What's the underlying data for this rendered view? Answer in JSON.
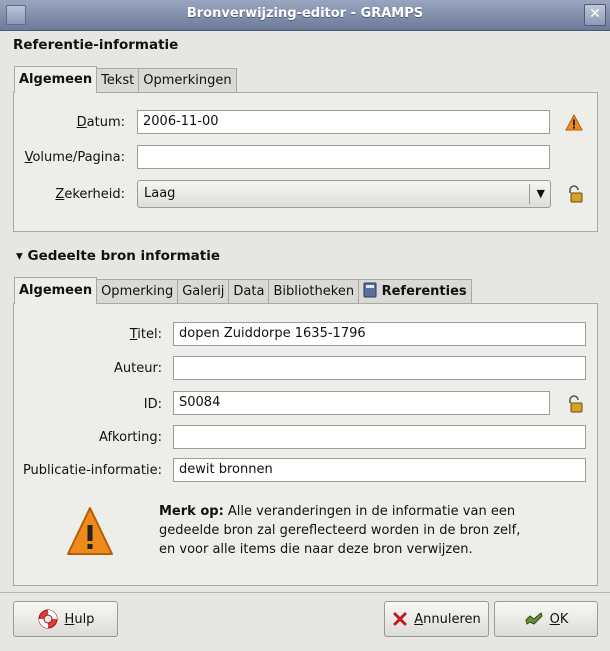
{
  "window": {
    "title": "Bronverwijzing-editor - GRAMPS",
    "close_glyph": "✕"
  },
  "reference": {
    "section_title": "Referentie-informatie",
    "tabs": [
      "Algemeen",
      "Tekst",
      "Opmerkingen"
    ],
    "active_tab": "Algemeen",
    "date_label_u": "D",
    "date_label_rest": "atum:",
    "date_value": "2006-11-00",
    "volume_label_u": "V",
    "volume_label_rest": "olume/Pagina:",
    "volume_value": "",
    "confidence_label_u": "Z",
    "confidence_label_rest": "ekerheid:",
    "confidence_value": "Laag",
    "combo_arrow": "▼"
  },
  "source": {
    "section_title": "Gedeelte bron informatie",
    "expander_glyph": "▾",
    "tabs": [
      "Algemeen",
      "Opmerking",
      "Galerij",
      "Data",
      "Bibliotheken",
      "Referenties"
    ],
    "active_tab": "Algemeen",
    "title_label_u": "T",
    "title_label_rest": "itel:",
    "title_value": "dopen Zuiddorpe 1635-1796",
    "author_label": "Auteur:",
    "author_value": "",
    "id_label": "ID:",
    "id_value": "S0084",
    "abbrev_label": "Afkorting:",
    "abbrev_value": "",
    "pub_label": "Publicatie-informatie:",
    "pub_value": "dewit bronnen",
    "note_bold": "Merk op:",
    "note_line1": " Alle veranderingen in de informatie van een",
    "note_line2": "gedeelde bron zal gereflecteerd worden in de bron zelf,",
    "note_line3": "en voor alle items die naar deze bron verwijzen."
  },
  "buttons": {
    "help_u": "H",
    "help_rest": "ulp",
    "cancel_u": "A",
    "cancel_rest": "nnuleren",
    "ok_u": "O",
    "ok_rest": "K"
  },
  "colors": {
    "warning": "#f08a1c",
    "titlebar": "#7f8cab"
  }
}
